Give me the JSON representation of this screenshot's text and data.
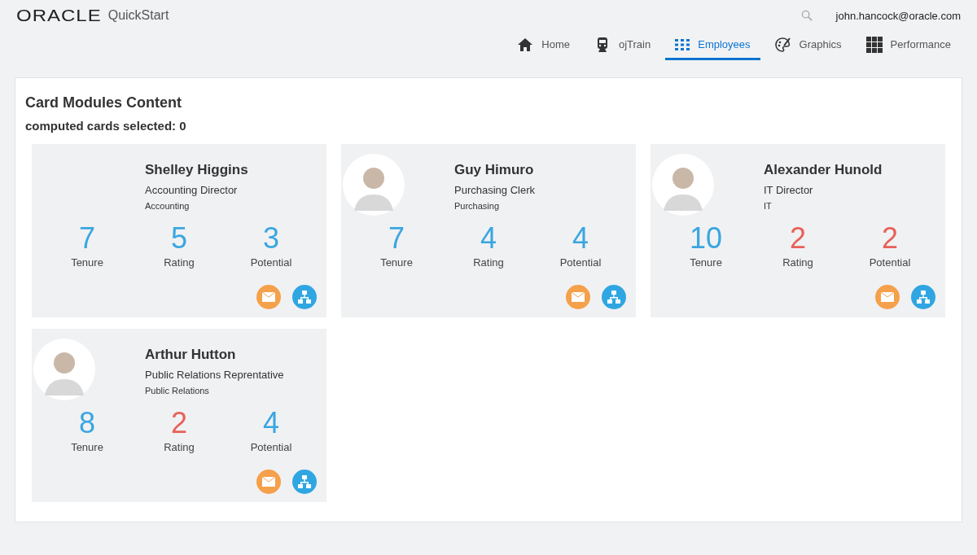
{
  "header": {
    "logo": "ORACLE",
    "product": "QuickStart",
    "user": "john.hancock@oracle.com"
  },
  "nav": [
    {
      "label": "Home",
      "kind": "home",
      "selected": false
    },
    {
      "label": "ojTrain",
      "kind": "train",
      "selected": false
    },
    {
      "label": "Employees",
      "kind": "grid9",
      "selected": true
    },
    {
      "label": "Graphics",
      "kind": "palette",
      "selected": false
    },
    {
      "label": "Performance",
      "kind": "grid",
      "selected": false
    }
  ],
  "title": "Card Modules Content",
  "subtitle": "computed cards selected: 0",
  "cards": [
    {
      "name": "Shelley Higgins",
      "job": "Accounting Director",
      "department": "Accounting",
      "photo": false,
      "metrics": [
        {
          "value": "7",
          "label": "Tenure",
          "color": "#3aa6e0"
        },
        {
          "value": "5",
          "label": "Rating",
          "color": "#3aa6e0"
        },
        {
          "value": "3",
          "label": "Potential",
          "color": "#3aa6e0"
        }
      ]
    },
    {
      "name": "Guy Himuro",
      "job": "Purchasing Clerk",
      "department": "Purchasing",
      "photo": true,
      "metrics": [
        {
          "value": "7",
          "label": "Tenure",
          "color": "#3aa6e0"
        },
        {
          "value": "4",
          "label": "Rating",
          "color": "#3aa6e0"
        },
        {
          "value": "4",
          "label": "Potential",
          "color": "#3aa6e0"
        }
      ]
    },
    {
      "name": "Alexander Hunold",
      "job": "IT Director",
      "department": "IT",
      "photo": true,
      "metrics": [
        {
          "value": "10",
          "label": "Tenure",
          "color": "#3aa6e0"
        },
        {
          "value": "2",
          "label": "Rating",
          "color": "#e8605a"
        },
        {
          "value": "2",
          "label": "Potential",
          "color": "#e8605a"
        }
      ]
    },
    {
      "name": "Arthur Hutton",
      "job": "Public Relations Reprentative",
      "department": "Public Relations",
      "photo": true,
      "metrics": [
        {
          "value": "8",
          "label": "Tenure",
          "color": "#3aa6e0"
        },
        {
          "value": "2",
          "label": "Rating",
          "color": "#e8605a"
        },
        {
          "value": "4",
          "label": "Potential",
          "color": "#3aa6e0"
        }
      ]
    }
  ]
}
